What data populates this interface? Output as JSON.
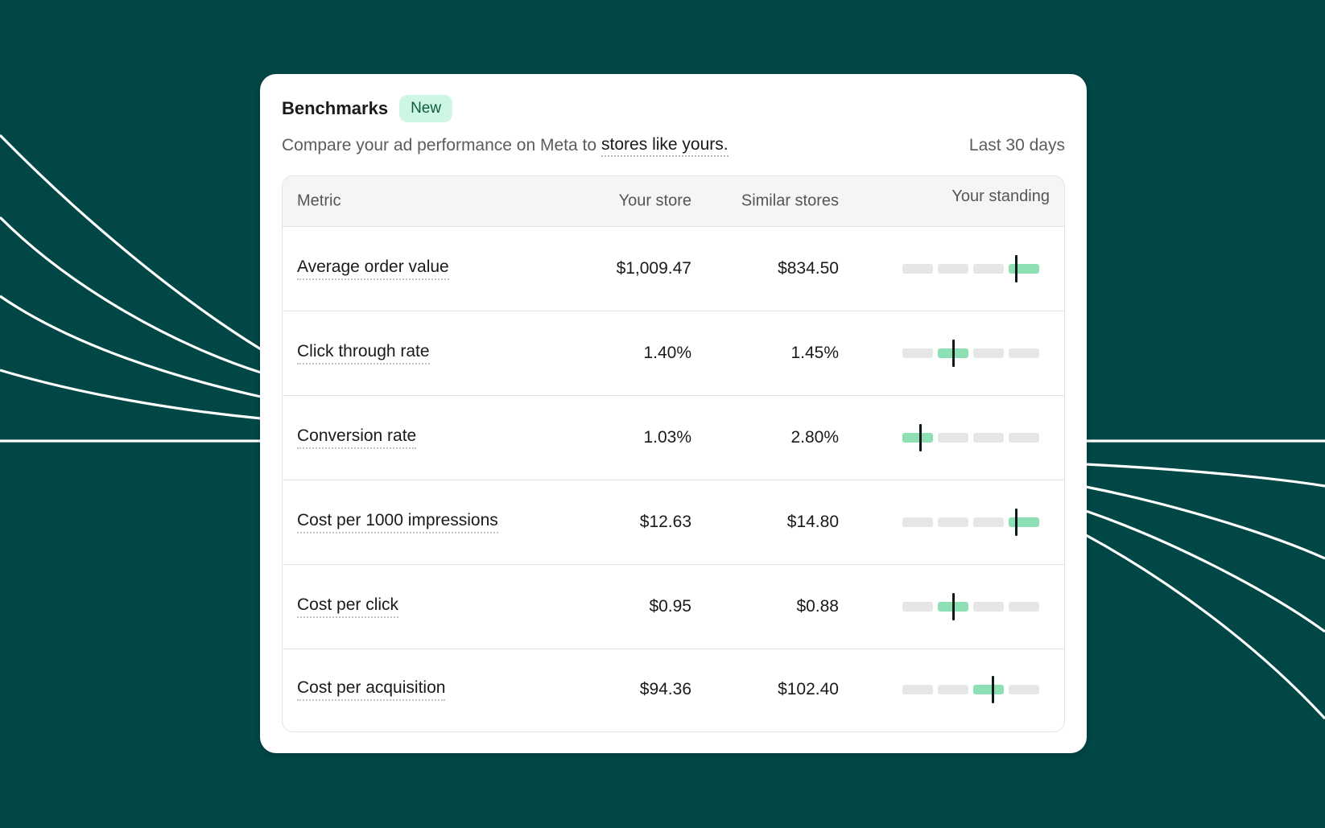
{
  "header": {
    "title": "Benchmarks",
    "badge": "New",
    "subtitle_text": "Compare your ad performance on Meta to",
    "subtitle_link": "stores like yours.",
    "date_range": "Last 30 days"
  },
  "table": {
    "columns": [
      "Metric",
      "Your store",
      "Similar stores",
      "Your standing"
    ],
    "rows": [
      {
        "metric": "Average order value",
        "your_store": "$1,009.47",
        "similar_stores": "$834.50",
        "standing_segment": 4,
        "marker_position": 0.25
      },
      {
        "metric": "Click through rate",
        "your_store": "1.40%",
        "similar_stores": "1.45%",
        "standing_segment": 2,
        "marker_position": 0.5
      },
      {
        "metric": "Conversion rate",
        "your_store": "1.03%",
        "similar_stores": "2.80%",
        "standing_segment": 1,
        "marker_position": 0.6
      },
      {
        "metric": "Cost per 1000 impressions",
        "your_store": "$12.63",
        "similar_stores": "$14.80",
        "standing_segment": 4,
        "marker_position": 0.25
      },
      {
        "metric": "Cost per click",
        "your_store": "$0.95",
        "similar_stores": "$0.88",
        "standing_segment": 2,
        "marker_position": 0.5
      },
      {
        "metric": "Cost per acquisition",
        "your_store": "$94.36",
        "similar_stores": "$102.40",
        "standing_segment": 3,
        "marker_position": 0.65
      }
    ]
  },
  "colors": {
    "background": "#004746",
    "accent_green": "#8ddfb4",
    "badge_bg": "#cdf7e2",
    "segment_inactive": "#e6e6e6",
    "marker": "#0e1a1a"
  }
}
